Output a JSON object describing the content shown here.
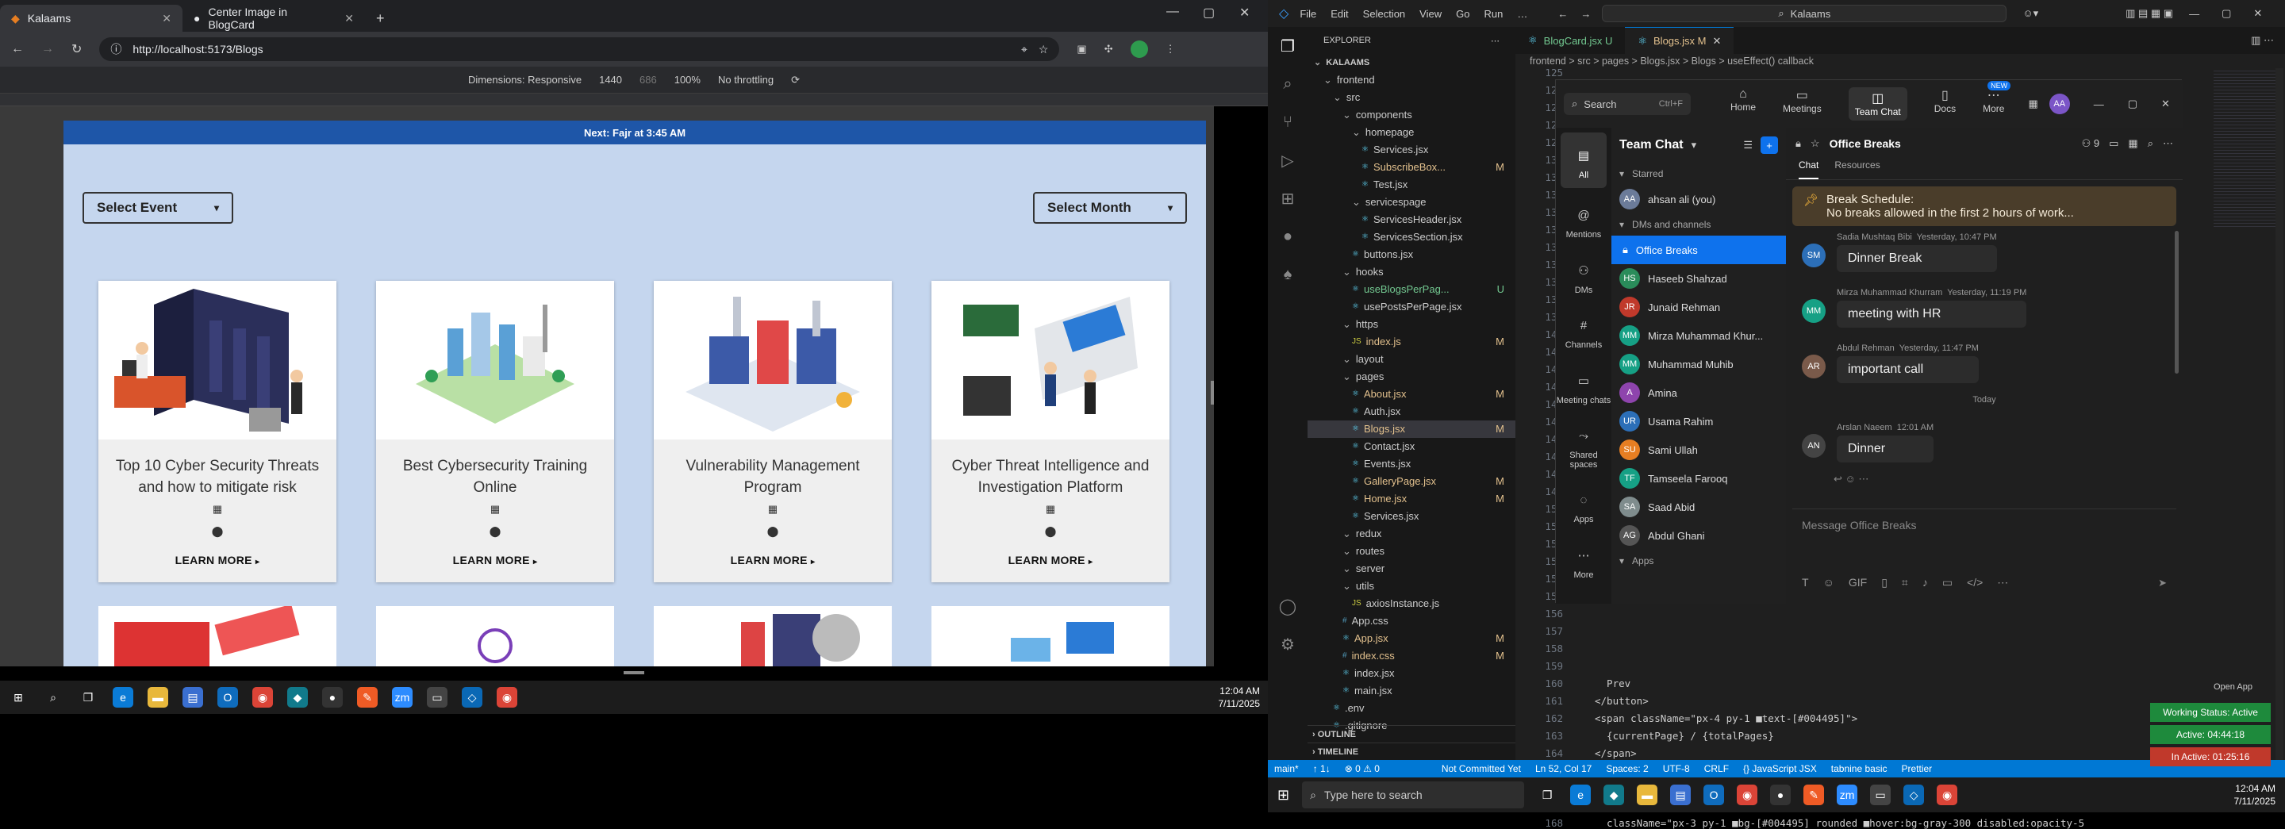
{
  "browser": {
    "tabs": [
      {
        "label": "Kalaams",
        "active": true
      },
      {
        "label": "Center Image in BlogCard",
        "active": false
      }
    ],
    "url": "http://localhost:5173/Blogs",
    "devtools": {
      "dimensions_label": "Dimensions: Responsive",
      "width": "1440",
      "height": "686",
      "zoom": "100%",
      "throttle": "No throttling"
    }
  },
  "site": {
    "banner": "Next: Fajr at 3:45 AM",
    "select_event": "Select Event",
    "select_month": "Select Month",
    "learn_more": "LEARN MORE",
    "cards": [
      {
        "title": "Top 10 Cyber Security Threats and how to mitigate risk"
      },
      {
        "title": "Best Cybersecurity Training Online"
      },
      {
        "title": "Vulnerability Management Program"
      },
      {
        "title": "Cyber Threat Intelligence and Investigation Platform"
      }
    ]
  },
  "taskbar_left": {
    "time": "12:04 AM",
    "date": "7/11/2025"
  },
  "vscode": {
    "menu": [
      "File",
      "Edit",
      "Selection",
      "View",
      "Go",
      "Run",
      "…"
    ],
    "search": "Kalaams",
    "explorer_title": "EXPLORER",
    "tree": [
      {
        "label": "KALAAMS",
        "indent": 0,
        "kind": "root"
      },
      {
        "label": "frontend",
        "indent": 1,
        "kind": "folder"
      },
      {
        "label": "src",
        "indent": 2,
        "kind": "folder"
      },
      {
        "label": "components",
        "indent": 3,
        "kind": "folder"
      },
      {
        "label": "homepage",
        "indent": 4,
        "kind": "folder"
      },
      {
        "label": "Services.jsx",
        "indent": 5,
        "kind": "file"
      },
      {
        "label": "SubscribeBox...",
        "indent": 5,
        "kind": "file",
        "badge": "M"
      },
      {
        "label": "Test.jsx",
        "indent": 5,
        "kind": "file"
      },
      {
        "label": "servicespage",
        "indent": 4,
        "kind": "folder"
      },
      {
        "label": "ServicesHeader.jsx",
        "indent": 5,
        "kind": "file"
      },
      {
        "label": "ServicesSection.jsx",
        "indent": 5,
        "kind": "file"
      },
      {
        "label": "buttons.jsx",
        "indent": 4,
        "kind": "file"
      },
      {
        "label": "hooks",
        "indent": 3,
        "kind": "folder"
      },
      {
        "label": "useBlogsPerPag...",
        "indent": 4,
        "kind": "file",
        "badge": "U"
      },
      {
        "label": "usePostsPerPage.jsx",
        "indent": 4,
        "kind": "file"
      },
      {
        "label": "https",
        "indent": 3,
        "kind": "folder"
      },
      {
        "label": "index.js",
        "indent": 4,
        "kind": "file",
        "badge": "M"
      },
      {
        "label": "layout",
        "indent": 3,
        "kind": "folder"
      },
      {
        "label": "pages",
        "indent": 3,
        "kind": "folder"
      },
      {
        "label": "About.jsx",
        "indent": 4,
        "kind": "file",
        "badge": "M"
      },
      {
        "label": "Auth.jsx",
        "indent": 4,
        "kind": "file"
      },
      {
        "label": "Blogs.jsx",
        "indent": 4,
        "kind": "file",
        "badge": "M",
        "selected": true
      },
      {
        "label": "Contact.jsx",
        "indent": 4,
        "kind": "file"
      },
      {
        "label": "Events.jsx",
        "indent": 4,
        "kind": "file"
      },
      {
        "label": "GalleryPage.jsx",
        "indent": 4,
        "kind": "file",
        "badge": "M"
      },
      {
        "label": "Home.jsx",
        "indent": 4,
        "kind": "file",
        "badge": "M"
      },
      {
        "label": "Services.jsx",
        "indent": 4,
        "kind": "file"
      },
      {
        "label": "redux",
        "indent": 3,
        "kind": "folder"
      },
      {
        "label": "routes",
        "indent": 3,
        "kind": "folder"
      },
      {
        "label": "server",
        "indent": 3,
        "kind": "folder"
      },
      {
        "label": "utils",
        "indent": 3,
        "kind": "folder"
      },
      {
        "label": "axiosInstance.js",
        "indent": 4,
        "kind": "file"
      },
      {
        "label": "App.css",
        "indent": 3,
        "kind": "file"
      },
      {
        "label": "App.jsx",
        "indent": 3,
        "kind": "file",
        "badge": "M"
      },
      {
        "label": "index.css",
        "indent": 3,
        "kind": "file",
        "badge": "M"
      },
      {
        "label": "index.jsx",
        "indent": 3,
        "kind": "file"
      },
      {
        "label": "main.jsx",
        "indent": 3,
        "kind": "file"
      },
      {
        "label": ".env",
        "indent": 2,
        "kind": "file"
      },
      {
        "label": ".gitignore",
        "indent": 2,
        "kind": "file"
      }
    ],
    "outline": "OUTLINE",
    "timeline": "TIMELINE",
    "editor_tabs": [
      {
        "label": "BlogCard.jsx U",
        "active": false
      },
      {
        "label": "Blogs.jsx M",
        "active": true
      }
    ],
    "breadcrumb": "frontend > src > pages > Blogs.jsx > Blogs > useEffect() callback",
    "line_numbers": [
      "125",
      "126",
      "127",
      "128",
      "129",
      "130",
      "131",
      "132",
      "133",
      "134",
      "135",
      "136",
      "137",
      "138",
      "139",
      "140",
      "141",
      "142",
      "143",
      "144",
      "145",
      "146",
      "147",
      "148",
      "149",
      "150",
      "151",
      "152",
      "153",
      "154",
      "155",
      "156",
      "157",
      "158",
      "159",
      "160",
      "161",
      "162",
      "163",
      "164",
      "165",
      "166",
      "167",
      "168"
    ],
    "code_lines": [
      {
        "n": "160",
        "text": "  Prev"
      },
      {
        "n": "161",
        "text": "</button>"
      },
      {
        "n": "162",
        "text": "<span className=\"px-4 py-1 ■text-[#004495]\">"
      },
      {
        "n": "163",
        "text": "  {currentPage} / {totalPages}"
      },
      {
        "n": "164",
        "text": "</span>"
      },
      {
        "n": "165",
        "text": "<button"
      },
      {
        "n": "166",
        "text": "  onClick={() => handlePageChange(currentPage + 1)}"
      },
      {
        "n": "167",
        "text": "  disabled={currentPage === totalPages}"
      },
      {
        "n": "168",
        "text": "  className=\"px-3 py-1 ■bg-[#004495] rounded ■hover:bg-gray-300 disabled:opacity-5"
      }
    ],
    "status": [
      "main*",
      "↑ 1↓",
      "⊗ 0 ⚠ 0",
      "Not Committed Yet",
      "Ln 52, Col 17",
      "Spaces: 2",
      "UTF-8",
      "CRLF",
      "{} JavaScript JSX",
      "tabnine basic",
      "Prettier"
    ],
    "open_app": "Open App"
  },
  "zoom": {
    "search": "Search",
    "shortcut": "Ctrl+F",
    "nav": [
      "Home",
      "Meetings",
      "Team Chat",
      "Docs",
      "More"
    ],
    "new_badge": "NEW",
    "avatar": "AA",
    "rail": [
      "All",
      "Mentions",
      "DMs",
      "Channels",
      "Meeting chats",
      "Shared spaces",
      "Apps",
      "More"
    ],
    "panel_title": "Team Chat",
    "sections": {
      "starred": "Starred",
      "dms": "DMs and channels",
      "apps": "Apps"
    },
    "starred": [
      {
        "name": "ahsan ali (you)",
        "initials": "AA",
        "color": "#6b7b99"
      }
    ],
    "contacts": [
      {
        "name": "Office Breaks",
        "selected": true
      },
      {
        "name": "Haseeb Shahzad",
        "initials": "HS",
        "color": "#2a8c5a"
      },
      {
        "name": "Junaid Rehman",
        "initials": "JR",
        "color": "#c0392b"
      },
      {
        "name": "Mirza Muhammad Khur...",
        "initials": "MM",
        "color": "#16a085"
      },
      {
        "name": "Muhammad Muhib",
        "initials": "MM",
        "color": "#16a085"
      },
      {
        "name": "Amina",
        "initials": "A",
        "color": "#8e44ad"
      },
      {
        "name": "Usama Rahim",
        "initials": "UR",
        "color": "#2c6fb8"
      },
      {
        "name": "Sami Ullah",
        "initials": "SU",
        "color": "#e67e22"
      },
      {
        "name": "Tamseela Farooq",
        "initials": "TF",
        "color": "#16a085"
      },
      {
        "name": "Saad Abid",
        "initials": "SA",
        "color": "#7f8c8d"
      },
      {
        "name": "Abdul Ghani",
        "initials": "AG",
        "color": "#555"
      }
    ],
    "channel": "Office Breaks",
    "members": "9",
    "chat_tabs": [
      "Chat",
      "Resources"
    ],
    "pinned_title": "Break Schedule:",
    "pinned_body": "No breaks allowed in the first 2 hours of work...",
    "messages": [
      {
        "sender": "Sadia Mushtaq Bibi",
        "time": "Yesterday, 10:47 PM",
        "text": "Dinner Break",
        "initials": "SM",
        "color": "#2c6fb8"
      },
      {
        "sender": "Mirza Muhammad Khurram",
        "time": "Yesterday, 11:19 PM",
        "text": "meeting with HR",
        "initials": "MM",
        "color": "#16a085"
      },
      {
        "sender": "Abdul Rehman",
        "time": "Yesterday, 11:47 PM",
        "text": "important call",
        "initials": "AR",
        "color": "#7a5a4a"
      },
      {
        "sender": "Arslan Naeem",
        "time": "12:01 AM",
        "text": "Dinner",
        "initials": "AN",
        "color": "#444"
      }
    ],
    "today": "Today",
    "composer": "Message Office Breaks"
  },
  "work_status": {
    "title": "Working Status: Active",
    "active": "Active: 04:44:18",
    "inactive": "In Active: 01:25:16"
  },
  "taskbar_right": {
    "search": "Type here to search",
    "time": "12:04 AM",
    "date": "7/11/2025"
  },
  "colors": {
    "accent": "#0078d4",
    "zoom_blue": "#0e72ed",
    "modified": "#e2c08d",
    "untracked": "#73c991",
    "site_banner": "#1e56a8",
    "site_bg": "#c5d6ee"
  }
}
